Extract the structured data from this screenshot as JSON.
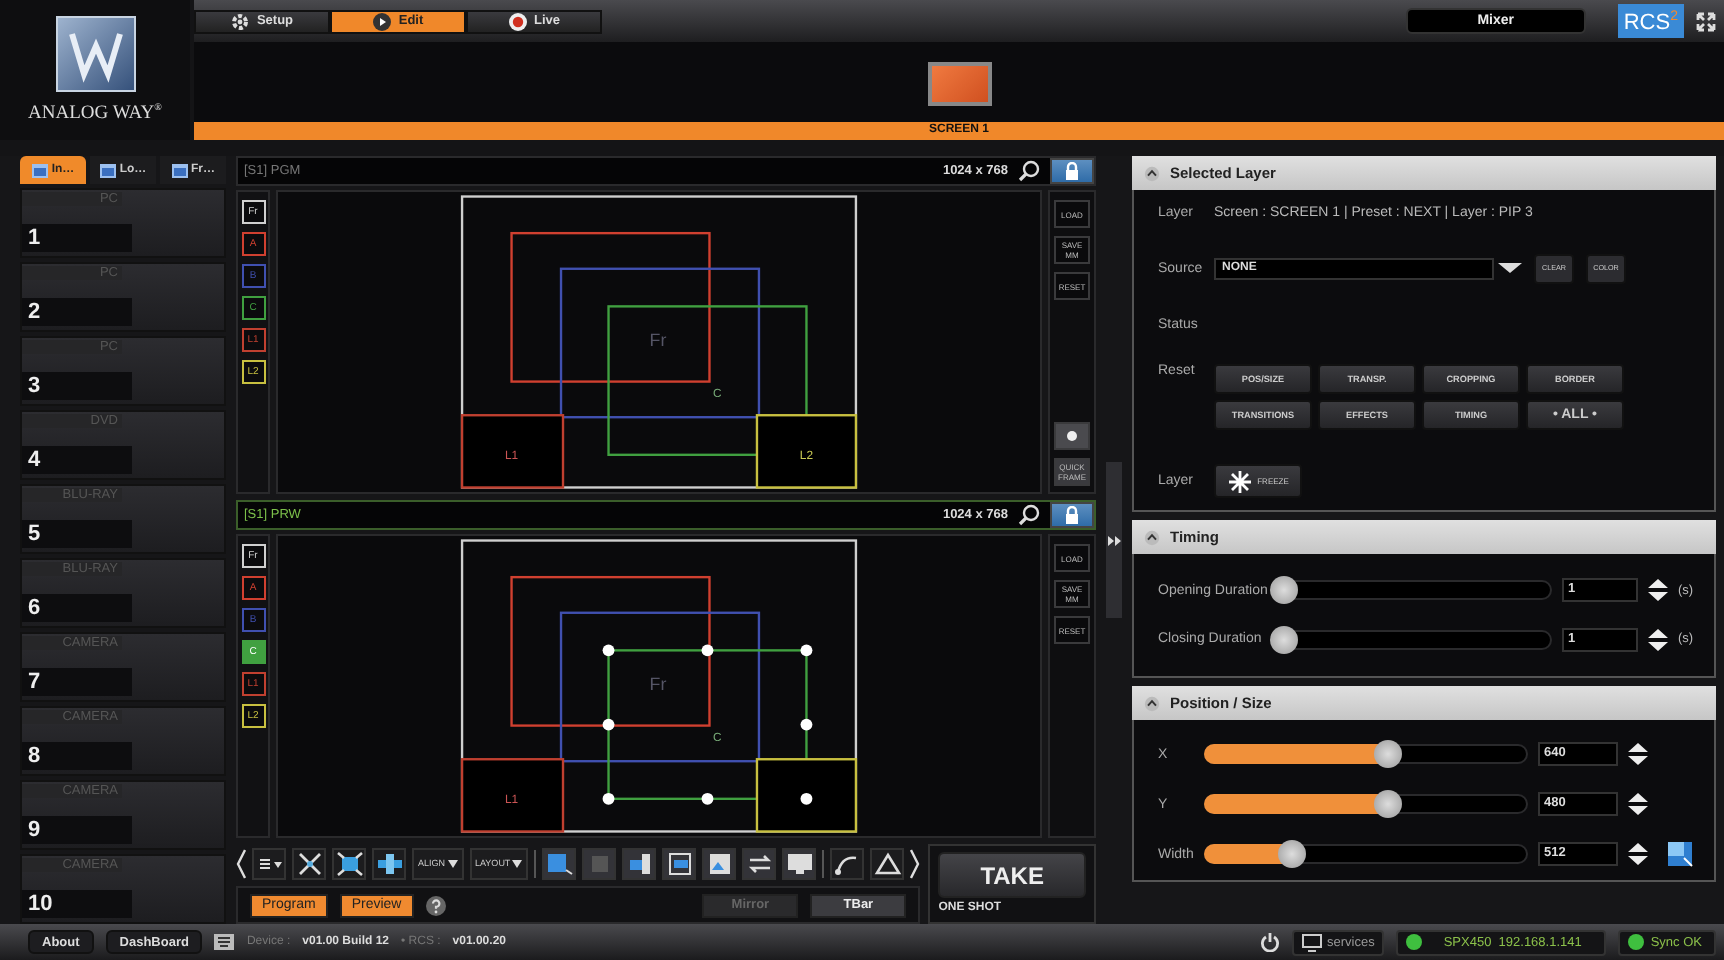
{
  "logo": {
    "text": "ANALOG WAY$^{®}$"
  },
  "top_tabs": [
    {
      "label": "Setup",
      "selected": false
    },
    {
      "label": "Edit",
      "selected": true
    },
    {
      "label": "Live",
      "selected": false
    }
  ],
  "mode_button": "Mixer",
  "product_logo": "RCS$^{2}$",
  "screen": {
    "label": "SCREEN 1"
  },
  "sidebar": {
    "tabs": [
      {
        "label": "In…",
        "selected": true
      },
      {
        "label": "Lo…",
        "selected": false
      },
      {
        "label": "Fr…",
        "selected": false
      }
    ],
    "inputs": [
      {
        "number": "1",
        "source": "PC"
      },
      {
        "number": "2",
        "source": "PC"
      },
      {
        "number": "3",
        "source": "PC"
      },
      {
        "number": "4",
        "source": "DVD"
      },
      {
        "number": "5",
        "source": "BLU-RAY"
      },
      {
        "number": "6",
        "source": "BLU-RAY"
      },
      {
        "number": "7",
        "source": "CAMERA"
      },
      {
        "number": "8",
        "source": "CAMERA"
      },
      {
        "number": "9",
        "source": "CAMERA"
      },
      {
        "number": "10",
        "source": "CAMERA"
      }
    ]
  },
  "monitors": [
    {
      "kind": "program",
      "title": "[S1] PGM",
      "resolution": "1024 x 768",
      "handles": false,
      "layers": [
        {
          "label": "Fr",
          "color": "#d0d0d0",
          "selected": false
        },
        {
          "label": "A",
          "color": "#d04030",
          "selected": false
        },
        {
          "label": "B",
          "color": "#4050b0",
          "selected": false
        },
        {
          "label": "C",
          "color": "#40a040",
          "selected": false
        },
        {
          "label": "L1",
          "color": "#c04030",
          "selected": false
        },
        {
          "label": "L2",
          "color": "#c8c040",
          "selected": false
        }
      ],
      "canvas_labels": [
        "Fr",
        "C",
        "L1",
        "L2"
      ],
      "side_buttons": [
        "LOAD",
        "SAVE MM",
        "RESET"
      ],
      "bottom_buttons": [
        "QUICK FRAME"
      ]
    },
    {
      "kind": "preview",
      "title": "[S1] PRW",
      "resolution": "1024 x 768",
      "handles": true,
      "layers": [
        {
          "label": "Fr",
          "color": "#d0d0d0",
          "selected": false
        },
        {
          "label": "A",
          "color": "#d04030",
          "selected": false
        },
        {
          "label": "B",
          "color": "#4050b0",
          "selected": false
        },
        {
          "label": "C",
          "color": "#40a040",
          "selected": true
        },
        {
          "label": "L1",
          "color": "#c04030",
          "selected": false
        },
        {
          "label": "L2",
          "color": "#c8c040",
          "selected": false
        }
      ],
      "canvas_labels": [
        "Fr",
        "C",
        "L1"
      ],
      "side_buttons": [
        "LOAD",
        "SAVE MM",
        "RESET"
      ]
    }
  ],
  "toolbar": {
    "menus": [
      "ALIGN",
      "LAYOUT"
    ]
  },
  "modes": [
    {
      "label": "Program",
      "on": true
    },
    {
      "label": "Preview",
      "on": true
    }
  ],
  "transition_buttons": [
    {
      "label": "Mirror",
      "disabled": true
    },
    {
      "label": "TBar",
      "disabled": false
    }
  ],
  "take": {
    "label": "TAKE",
    "mode": "ONE SHOT"
  },
  "selected_layer": {
    "title": "Selected Layer",
    "layer_label": "Layer",
    "layer_info": "Screen : SCREEN 1 | Preset : NEXT | Layer : PIP 3",
    "source_label": "Source",
    "source_value": "NONE",
    "source_buttons": [
      "CLEAR",
      "COLOR"
    ],
    "status_label": "Status",
    "reset_label": "Reset",
    "reset_buttons": [
      "POS/SIZE",
      "TRANSP.",
      "CROPPING",
      "BORDER",
      "TRANSITIONS",
      "EFFECTS",
      "TIMING",
      "• ALL •"
    ],
    "freeze_label": "Layer",
    "freeze_button": "FREEZE"
  },
  "timing": {
    "title": "Timing",
    "rows": [
      {
        "label": "Opening Duration",
        "level": 0.04,
        "value": "1",
        "unit": "(s)"
      },
      {
        "label": "Closing Duration",
        "level": 0.04,
        "value": "1",
        "unit": "(s)"
      }
    ]
  },
  "position_size": {
    "title": "Position / Size",
    "rows": [
      {
        "label": "X",
        "level": 0.57,
        "value": "640"
      },
      {
        "label": "Y",
        "level": 0.57,
        "value": "480"
      },
      {
        "label": "Width",
        "level": 0.27,
        "value": "512"
      }
    ]
  },
  "status_bar": {
    "buttons": [
      "About",
      "DashBoard"
    ],
    "device_label": "Device :",
    "device_version": "v01.00 Build 12",
    "rcs_label": "• RCS :",
    "rcs_version": "v01.00.20",
    "services": "services",
    "device": "SPX450  192.168.1.141",
    "sync": "Sync OK"
  }
}
